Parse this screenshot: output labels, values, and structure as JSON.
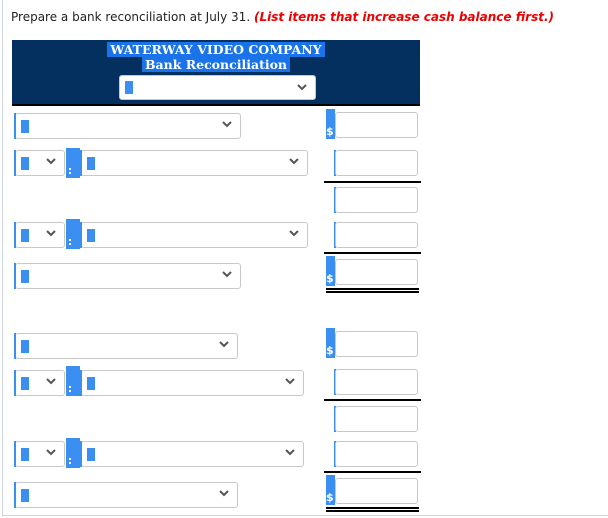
{
  "instruction": {
    "text": "Prepare a bank reconciliation at July 31.",
    "note": "(List items that increase cash balance first.)"
  },
  "header": {
    "company": "WATERWAY VIDEO COMPANY",
    "statement": "Bank Reconciliation",
    "date_select": {
      "value": ""
    }
  },
  "icons": {
    "dropdown": "chevron-down-icon",
    "currency": "$"
  },
  "rows": [
    {
      "type": "select-amount",
      "label_value": "",
      "amount": "",
      "currency": "$"
    },
    {
      "type": "prefix-select-amount",
      "prefix_value": "",
      "label_value": "",
      "amount": ""
    },
    {
      "type": "amount",
      "amount": ""
    },
    {
      "type": "prefix-select-amount",
      "prefix_value": "",
      "label_value": "",
      "amount": ""
    },
    {
      "type": "select-amount",
      "label_value": "",
      "amount": "",
      "currency": "$"
    },
    {
      "type": "select-amount",
      "label_value": "",
      "amount": "",
      "currency": "$"
    },
    {
      "type": "prefix-select-amount",
      "prefix_value": "",
      "label_value": "",
      "amount": ""
    },
    {
      "type": "amount",
      "amount": ""
    },
    {
      "type": "prefix-select-amount",
      "prefix_value": "",
      "label_value": "",
      "amount": ""
    },
    {
      "type": "select-amount",
      "label_value": "",
      "amount": "",
      "currency": "$"
    }
  ],
  "colors": {
    "header_bg": "#03305f",
    "accent": "#3b8ff0",
    "note": "#ee0000"
  }
}
